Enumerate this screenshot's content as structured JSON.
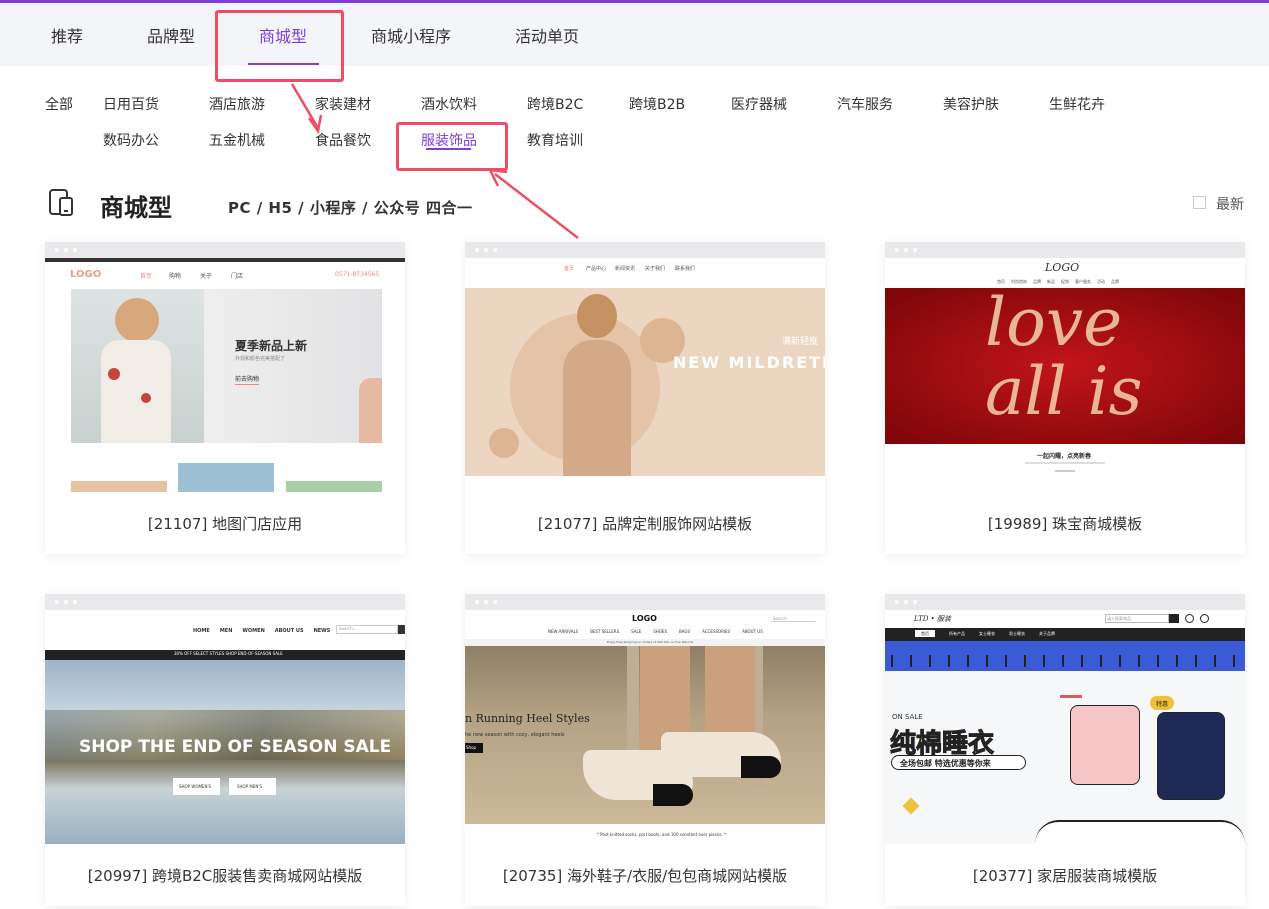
{
  "top_tabs": [
    {
      "label": "推荐"
    },
    {
      "label": "品牌型"
    },
    {
      "label": "商城型"
    },
    {
      "label": "商城小程序"
    },
    {
      "label": "活动单页"
    }
  ],
  "categories_row1": [
    "全部",
    "日用百货",
    "酒店旅游",
    "家装建材",
    "酒水饮料",
    "跨境B2C",
    "跨境B2B",
    "医疗器械",
    "汽车服务",
    "美容护肤",
    "生鲜花卉"
  ],
  "categories_row2": [
    "数码办公",
    "五金机械",
    "食品餐饮",
    "服装饰品",
    "教育培训"
  ],
  "section": {
    "title": "商城型",
    "subtitle": "PC / H5 / 小程序 / 公众号 四合一",
    "newest_label": "最新"
  },
  "cards": [
    {
      "caption": "[21107] 地图门店应用",
      "thumb": {
        "logo": "LOGO",
        "nav": [
          "首页",
          "购物",
          "关于",
          "门店"
        ],
        "phone": "0571-8734565",
        "headline": "夏季新品上新",
        "sub": "外观和颜色完美搭配了",
        "cta": "前去购物"
      }
    },
    {
      "caption": "[21077] 品牌定制服饰网站模板",
      "thumb": {
        "nav": [
          "首页",
          "产品中心",
          "新闻资讯",
          "关于我们",
          "联系我们"
        ],
        "headline": "NEW  MILDRETE",
        "sub": "满新轻度"
      }
    },
    {
      "caption": "[19989] 珠宝商城模板",
      "thumb": {
        "logo": "LOGO",
        "nav": [
          "首页",
          "时尚首饰",
          "品牌",
          "新品",
          "促销",
          "客户服务",
          "活动",
          "品牌"
        ],
        "script_text": "love all is",
        "tag": "一起闪耀，点亮新春"
      }
    },
    {
      "caption": "[20997] 跨境B2C服装售卖商城网站模版",
      "thumb": {
        "nav": [
          "HOME",
          "MEN",
          "WOMEN",
          "ABOUT US",
          "NEWS"
        ],
        "search": "Search...",
        "promo": "30% OFF SELECT STYLES SHOP END-OF-SEASON SALE",
        "headline": "SHOP THE END OF SEASON SALE",
        "btn1": "SHOP WOMEN'S",
        "btn2": "SHOP MEN'S"
      }
    },
    {
      "caption": "[20735] 海外鞋子/衣服/包包商城网站模版",
      "thumb": {
        "logo": "LOGO",
        "nav": [
          "NEW ARRIVALS",
          "BEST SELLERS",
          "SALE",
          "SHOES",
          "BAGS",
          "ACCESSORIES",
          "ABOUT US"
        ],
        "search": "Search",
        "shipping": "Enjoy Free Shipping on Orders of $99.00+ & Free Returns",
        "headline": "n Running Heel Styles",
        "sub": "he new season with cozy, elegant heels",
        "btn": "Shop",
        "footnote": "* Post knitted socks, port boots, and 100 constant over pieces. *"
      }
    },
    {
      "caption": "[20377] 家居服装商城模版",
      "thumb": {
        "logo": "LTD • 服装",
        "search": "请入搜索商品",
        "nav": [
          "首页",
          "所有产品",
          "女士睡衣",
          "男士睡衣",
          "关于品牌"
        ],
        "on_sale": "ON SALE",
        "headline": "纯棉睡衣",
        "badge": "特惠",
        "pill": "全场包邮 特选优惠等你来"
      }
    }
  ],
  "colors": {
    "accent": "#7d3fd6",
    "highlight": "#ee4d68"
  }
}
